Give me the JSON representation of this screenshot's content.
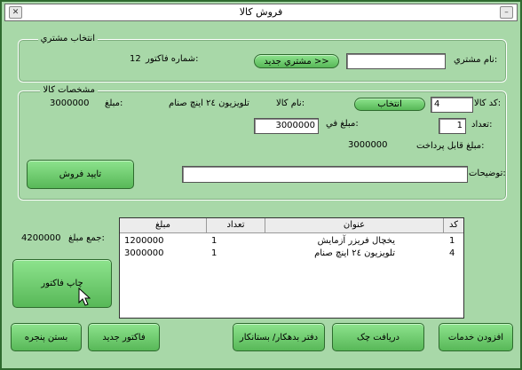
{
  "window": {
    "title": "فروش کالا",
    "close_icon": "close-icon",
    "minimize_icon": "minimize-icon"
  },
  "customer": {
    "group_title": "انتخاب مشتري",
    "name_label": "نام مشتري:",
    "name_value": "",
    "new_customer_label": "مشتري جديد >>",
    "invoice_no_label": "شماره فاکتور:",
    "invoice_no_value": "12"
  },
  "goods": {
    "group_title": "مشخصات کالا",
    "code_label": "کد کالا:",
    "code_value": "4",
    "select_label": "انتخاب",
    "goods_name_label": "نام کالا:",
    "goods_name_value": "تلويزيون ٢٤ اينچ صنام",
    "amount_label": "مبلغ:",
    "amount_value": "3000000",
    "qty_label": "تعداد:",
    "qty_value": "1",
    "unit_price_label": "مبلغ في:",
    "unit_price_value": "3000000",
    "payable_label": "مبلغ قابل پرداخت:",
    "payable_value": "3000000",
    "desc_label": "توضيحات:",
    "desc_value": "",
    "confirm_label": "تاييد فروش"
  },
  "table": {
    "headers": {
      "code": "کد",
      "title": "عنوان",
      "qty": "تعداد",
      "amount": "مبلغ"
    },
    "rows": [
      {
        "code": "1",
        "title": "يخچال فريزر آزمايش",
        "qty": "1",
        "amount": "1200000"
      },
      {
        "code": "4",
        "title": "تلويزيون ٢٤ اينچ صنام",
        "qty": "1",
        "amount": "3000000"
      }
    ]
  },
  "total": {
    "label": "جمع مبلغ:",
    "value": "4200000"
  },
  "buttons": {
    "print_invoice": "چاپ فاکتور",
    "add_services": "افزودن خدمات",
    "receive_check": "دريافت چک",
    "ledger": "دفتر بدهکار/ بستانکار",
    "new_invoice": "فاکتور جديد",
    "close_window": "بستن پنجره"
  },
  "colors": {
    "window_bg": "#a8d8a8",
    "button": "#6fcf6f",
    "frame": "#2f6a2f"
  }
}
